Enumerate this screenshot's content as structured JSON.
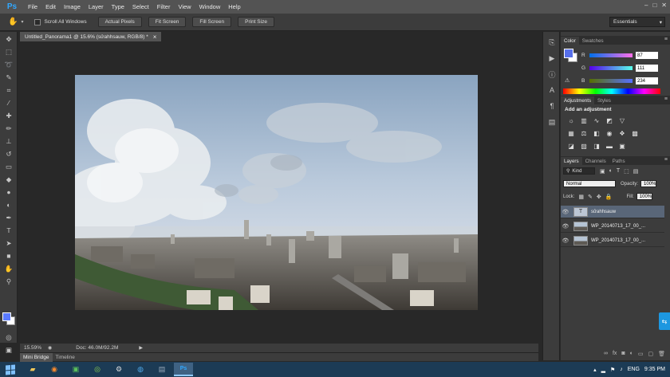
{
  "menubar": {
    "logo": "Ps",
    "items": [
      "File",
      "Edit",
      "Image",
      "Layer",
      "Type",
      "Select",
      "Filter",
      "View",
      "Window",
      "Help"
    ],
    "window_controls": [
      "–",
      "□",
      "✕"
    ]
  },
  "options": {
    "scroll_all": "Scroll All Windows",
    "buttons": [
      "Actual Pixels",
      "Fit Screen",
      "Fill Screen",
      "Print Size"
    ],
    "workspace": "Essentials"
  },
  "document": {
    "tab_title": "Untitled_Panorama1 @ 15.6% (sửahhsauw, RGB/8) *",
    "close": "×",
    "zoom": "15.59%",
    "doc_info": "Doc: 46.0M/92.2M"
  },
  "bottom_tabs": [
    "Mini Bridge",
    "Timeline"
  ],
  "color_panel": {
    "tabs": [
      "Color",
      "Swatches"
    ],
    "channels": [
      {
        "label": "R",
        "value": "87"
      },
      {
        "label": "G",
        "value": "111"
      },
      {
        "label": "B",
        "value": "234"
      }
    ],
    "fg_color": "#576FEA"
  },
  "adjustments_panel": {
    "tabs": [
      "Adjustments",
      "Styles"
    ],
    "title": "Add an adjustment"
  },
  "layers_panel": {
    "tabs": [
      "Layers",
      "Channels",
      "Paths"
    ],
    "filter": "Kind",
    "blend_mode": "Normal",
    "opacity_label": "Opacity:",
    "opacity": "100%",
    "lock_label": "Lock:",
    "fill_label": "Fill:",
    "fill": "100%",
    "layers": [
      {
        "name": "sửahhsauw",
        "type": "text",
        "selected": true
      },
      {
        "name": "WP_20140713_17_00_...",
        "type": "image",
        "selected": false
      },
      {
        "name": "WP_20140713_17_00_...",
        "type": "image",
        "selected": false
      }
    ]
  },
  "taskbar": {
    "language": "ENG",
    "time": "9:35 PM"
  }
}
